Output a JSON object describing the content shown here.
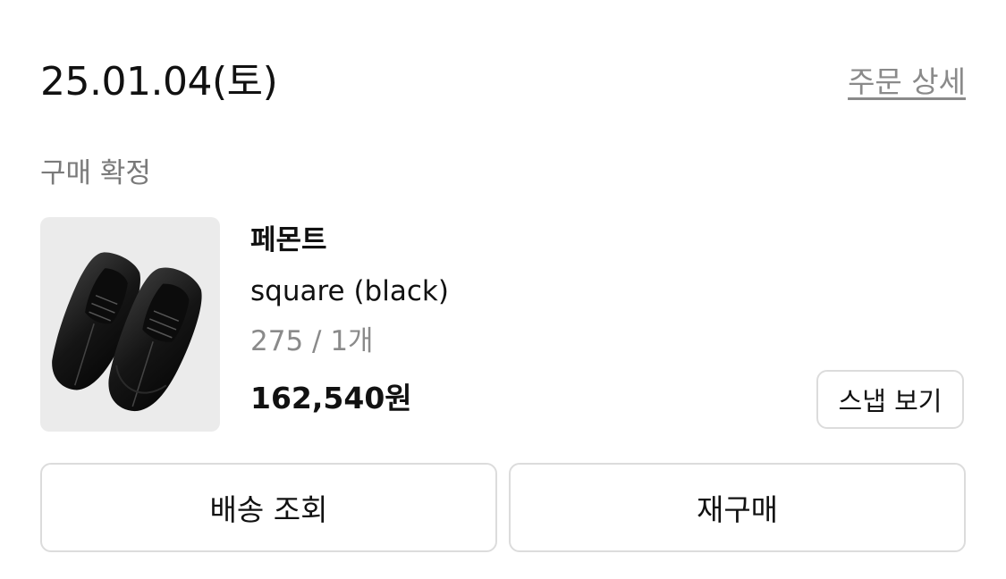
{
  "order": {
    "date": "25.01.04(토)",
    "detail_link": "주문 상세",
    "status": "구매 확정"
  },
  "product": {
    "image_icon": "sneaker-product-image",
    "brand": "페몬트",
    "name": "square (black)",
    "option": "275 / 1개",
    "price": "162,540원",
    "snap_label": "스냅 보기"
  },
  "actions": {
    "track_label": "배송 조회",
    "reorder_label": "재구매"
  },
  "colors": {
    "text": "#111111",
    "muted": "#8a8a8a",
    "border": "#dcdcdc",
    "thumb_bg": "#ebebeb"
  }
}
